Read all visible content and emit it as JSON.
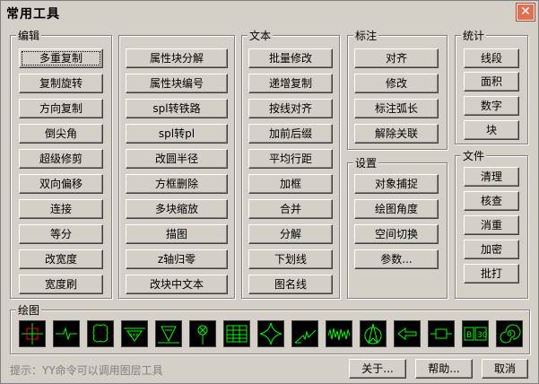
{
  "window": {
    "title": "常用工具",
    "close_glyph": "✕"
  },
  "groups": {
    "edit": {
      "label": "编辑",
      "buttons": [
        "多重复制",
        "复制旋转",
        "方向复制",
        "倒尖角",
        "超级修剪",
        "双向偏移",
        "连接",
        "等分",
        "改宽度",
        "宽度刷"
      ]
    },
    "block": {
      "buttons": [
        "属性块分解",
        "属性块编号",
        "spl转铁路",
        "spl转pl",
        "改圆半径",
        "方框删除",
        "多块缩放",
        "描图",
        "z轴归零",
        "改块中文本"
      ]
    },
    "text": {
      "label": "文本",
      "buttons": [
        "批量修改",
        "递增复制",
        "按线对齐",
        "加前后缀",
        "平均行距",
        "加框",
        "合并",
        "分解",
        "下划线",
        "图名线"
      ]
    },
    "dim": {
      "label": "标注",
      "buttons": [
        "对齐",
        "修改",
        "标注弧长",
        "解除关联"
      ]
    },
    "settings": {
      "label": "设置",
      "buttons": [
        "对象捕捉",
        "绘图角度",
        "空间切换",
        "参数..."
      ]
    },
    "stats": {
      "label": "统计",
      "buttons": [
        "线段",
        "面积",
        "数字",
        "块"
      ]
    },
    "file": {
      "label": "文件",
      "buttons": [
        "清理",
        "核查",
        "消重",
        "加密",
        "批打"
      ]
    },
    "draw": {
      "label": "绘图",
      "icons": [
        "crosshair-icon",
        "break-line-icon",
        "cloud-rect-icon",
        "triangle-arrow-icon",
        "valve-icon",
        "pin-circle-icon",
        "grid-table-icon",
        "star-icon",
        "squiggle-icon",
        "wave-icon",
        "north-arrow-icon",
        "left-arrow-icon",
        "resistor-icon",
        "text-box-icon",
        "spiral-icon"
      ]
    }
  },
  "footer": {
    "hint": "提示：YY命令可以调用图层工具",
    "about": "关于...",
    "help": "帮助...",
    "cancel": "取消"
  },
  "colors": {
    "dialog_bg": "#d4d0c8",
    "icon_bg": "#000000",
    "icon_green": "#00ff00",
    "icon_red": "#ff0000",
    "close_red": "#e07050"
  }
}
